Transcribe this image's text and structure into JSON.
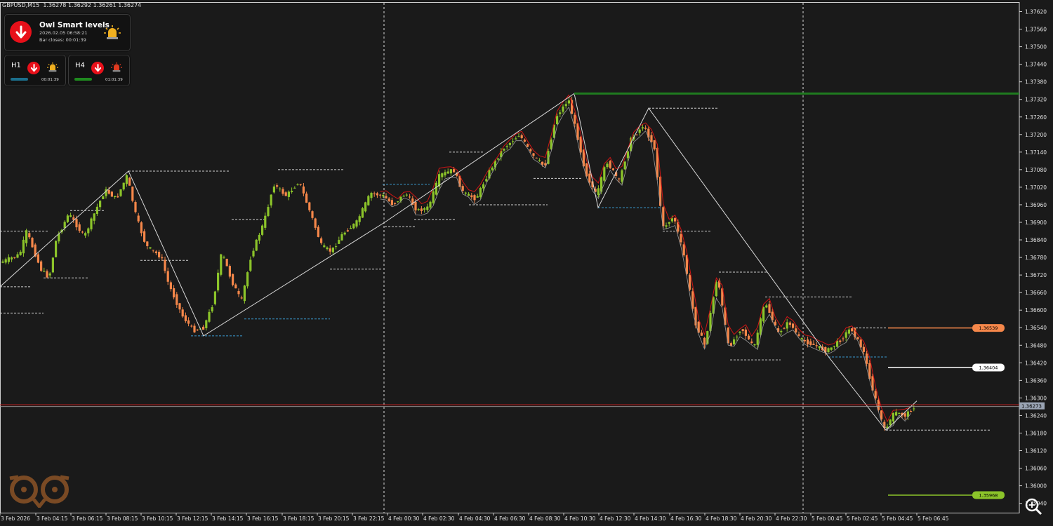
{
  "symbol_info": "GBPUSD,M15  1.36278 1.36292 1.36261 1.36274",
  "panel": {
    "title": "Owl Smart levels",
    "datetime": "2026.02.05 06:58:21",
    "bar_closes": "Bar closes: 00:01:39",
    "tf1": {
      "label": "H1",
      "time": "00:01:39",
      "bar_color": "#1b6f8c"
    },
    "tf2": {
      "label": "H4",
      "time": "01:01:39",
      "bar_color": "#1f8a1f"
    }
  },
  "colors": {
    "background": "#1a1a1a",
    "bull": "#8cc42a",
    "bear": "#f5874a",
    "zigzag": "#d8d8d8",
    "envelope": "#d01515",
    "level_top": "#1f7a1f",
    "level_orange": "#f5874a",
    "level_white": "#ffffff",
    "level_green": "#8cc42a",
    "price_line": "#d02020"
  },
  "chart_data": {
    "type": "candlestick",
    "symbol": "GBPUSD",
    "timeframe": "M15",
    "ylim": [
      1.35908,
      1.3765
    ],
    "y_ticks": [
      "1.37620",
      "1.37560",
      "1.37500",
      "1.37440",
      "1.37380",
      "1.37320",
      "1.37260",
      "1.37200",
      "1.37140",
      "1.37080",
      "1.37020",
      "1.36960",
      "1.36900",
      "1.36840",
      "1.36780",
      "1.36720",
      "1.36660",
      "1.36600",
      "1.36540",
      "1.36480",
      "1.36420",
      "1.36360",
      "1.36300",
      "1.36240",
      "1.36180",
      "1.36120",
      "1.36060",
      "1.36000",
      "1.35940"
    ],
    "x_labels": [
      "3 Feb 2026",
      "3 Feb 04:15",
      "3 Feb 06:15",
      "3 Feb 08:15",
      "3 Feb 10:15",
      "3 Feb 12:15",
      "3 Feb 14:15",
      "3 Feb 16:15",
      "3 Feb 18:15",
      "3 Feb 20:15",
      "3 Feb 22:15",
      "4 Feb 00:30",
      "4 Feb 02:30",
      "4 Feb 04:30",
      "4 Feb 06:30",
      "4 Feb 08:30",
      "4 Feb 10:30",
      "4 Feb 12:30",
      "4 Feb 14:30",
      "4 Feb 16:30",
      "4 Feb 18:30",
      "4 Feb 20:30",
      "4 Feb 22:30",
      "5 Feb 00:45",
      "5 Feb 02:45",
      "5 Feb 04:45",
      "5 Feb 06:45"
    ],
    "day_separators": [
      "4 Feb 00:00",
      "5 Feb 00:00"
    ],
    "current_price": {
      "value": 1.36273,
      "label": "1.36273"
    },
    "levels": [
      {
        "name": "resistance-top",
        "value": 1.3734,
        "label": "",
        "color": "#1f7a1f"
      },
      {
        "name": "level-orange",
        "value": 1.36539,
        "label": "1.36539",
        "color": "#f5874a"
      },
      {
        "name": "level-white",
        "value": 1.36404,
        "label": "1.36404",
        "color": "#ffffff"
      },
      {
        "name": "level-green",
        "value": 1.35968,
        "label": "1.35968",
        "color": "#8cc42a"
      }
    ],
    "price_path": [
      [
        0,
        1.3676
      ],
      [
        30,
        1.3679
      ],
      [
        40,
        1.3687
      ],
      [
        60,
        1.3674
      ],
      [
        72,
        1.3671
      ],
      [
        82,
        1.3684
      ],
      [
        100,
        1.3693
      ],
      [
        122,
        1.3685
      ],
      [
        140,
        1.3695
      ],
      [
        152,
        1.3701
      ],
      [
        168,
        1.3698
      ],
      [
        183,
        1.3706
      ],
      [
        196,
        1.3692
      ],
      [
        210,
        1.3682
      ],
      [
        232,
        1.3678
      ],
      [
        242,
        1.3669
      ],
      [
        262,
        1.3658
      ],
      [
        278,
        1.3653
      ],
      [
        292,
        1.3654
      ],
      [
        305,
        1.3662
      ],
      [
        318,
        1.368
      ],
      [
        332,
        1.367
      ],
      [
        346,
        1.3663
      ],
      [
        360,
        1.3679
      ],
      [
        378,
        1.369
      ],
      [
        392,
        1.3703
      ],
      [
        410,
        1.3699
      ],
      [
        428,
        1.3704
      ],
      [
        446,
        1.3692
      ],
      [
        460,
        1.3682
      ],
      [
        474,
        1.368
      ],
      [
        490,
        1.3686
      ],
      [
        510,
        1.369
      ],
      [
        530,
        1.37
      ],
      [
        548,
        1.3699
      ],
      [
        562,
        1.3696
      ],
      [
        580,
        1.37
      ],
      [
        596,
        1.3694
      ],
      [
        612,
        1.3695
      ],
      [
        628,
        1.3706
      ],
      [
        648,
        1.3708
      ],
      [
        662,
        1.37
      ],
      [
        680,
        1.3698
      ],
      [
        698,
        1.3707
      ],
      [
        718,
        1.3715
      ],
      [
        742,
        1.372
      ],
      [
        760,
        1.3713
      ],
      [
        778,
        1.3709
      ],
      [
        794,
        1.3726
      ],
      [
        812,
        1.3732
      ],
      [
        824,
        1.372
      ],
      [
        836,
        1.3707
      ],
      [
        852,
        1.3699
      ],
      [
        866,
        1.3711
      ],
      [
        884,
        1.3704
      ],
      [
        900,
        1.3718
      ],
      [
        918,
        1.3723
      ],
      [
        934,
        1.3716
      ],
      [
        946,
        1.3688
      ],
      [
        962,
        1.3692
      ],
      [
        976,
        1.3679
      ],
      [
        992,
        1.3656
      ],
      [
        1006,
        1.3648
      ],
      [
        1024,
        1.3672
      ],
      [
        1040,
        1.3647
      ],
      [
        1058,
        1.3654
      ],
      [
        1076,
        1.3647
      ],
      [
        1092,
        1.3663
      ],
      [
        1110,
        1.3652
      ],
      [
        1126,
        1.3656
      ],
      [
        1142,
        1.365
      ],
      [
        1162,
        1.3648
      ],
      [
        1180,
        1.3646
      ],
      [
        1200,
        1.365
      ],
      [
        1214,
        1.3654
      ],
      [
        1232,
        1.3646
      ],
      [
        1246,
        1.3632
      ],
      [
        1262,
        1.3619
      ],
      [
        1276,
        1.3625
      ],
      [
        1292,
        1.3624
      ],
      [
        1306,
        1.36274
      ]
    ],
    "zigzag": [
      [
        0,
        1.3668
      ],
      [
        183,
        1.37075
      ],
      [
        290,
        1.36512
      ],
      [
        548,
        1.369
      ],
      [
        818,
        1.3734
      ],
      [
        852,
        1.3695
      ],
      [
        924,
        1.3729
      ],
      [
        1182,
        1.36435
      ],
      [
        1262,
        1.3619
      ],
      [
        1306,
        1.3629
      ]
    ],
    "dashed_levels": [
      {
        "x1": 0,
        "x2": 45,
        "value": 1.3668,
        "color": "#cfcfcf"
      },
      {
        "x1": 0,
        "x2": 62,
        "value": 1.3659,
        "color": "#cfcfcf"
      },
      {
        "x1": 0,
        "x2": 70,
        "value": 1.3687,
        "color": "#cfcfcf"
      },
      {
        "x1": 62,
        "x2": 126,
        "value": 1.3671,
        "color": "#cfcfcf"
      },
      {
        "x1": 100,
        "x2": 150,
        "value": 1.3694,
        "color": "#cfcfcf"
      },
      {
        "x1": 183,
        "x2": 326,
        "value": 1.37075,
        "color": "#cfcfcf"
      },
      {
        "x1": 200,
        "x2": 268,
        "value": 1.3677,
        "color": "#cfcfcf"
      },
      {
        "x1": 272,
        "x2": 345,
        "value": 1.36512,
        "color": "#3a9ad0"
      },
      {
        "x1": 330,
        "x2": 378,
        "value": 1.3691,
        "color": "#cfcfcf"
      },
      {
        "x1": 348,
        "x2": 470,
        "value": 1.3657,
        "color": "#3a9ad0"
      },
      {
        "x1": 396,
        "x2": 490,
        "value": 1.3708,
        "color": "#cfcfcf"
      },
      {
        "x1": 470,
        "x2": 545,
        "value": 1.3674,
        "color": "#cfcfcf"
      },
      {
        "x1": 545,
        "x2": 612,
        "value": 1.3703,
        "color": "#3a9ad0"
      },
      {
        "x1": 548,
        "x2": 592,
        "value": 1.36885,
        "color": "#cfcfcf"
      },
      {
        "x1": 590,
        "x2": 648,
        "value": 1.3691,
        "color": "#cfcfcf"
      },
      {
        "x1": 640,
        "x2": 690,
        "value": 1.3714,
        "color": "#cfcfcf"
      },
      {
        "x1": 668,
        "x2": 780,
        "value": 1.3696,
        "color": "#cfcfcf"
      },
      {
        "x1": 760,
        "x2": 830,
        "value": 1.3705,
        "color": "#cfcfcf"
      },
      {
        "x1": 852,
        "x2": 940,
        "value": 1.3695,
        "color": "#3a9ad0"
      },
      {
        "x1": 924,
        "x2": 1024,
        "value": 1.3729,
        "color": "#cfcfcf"
      },
      {
        "x1": 944,
        "x2": 1012,
        "value": 1.3687,
        "color": "#cfcfcf"
      },
      {
        "x1": 1024,
        "x2": 1094,
        "value": 1.3673,
        "color": "#cfcfcf"
      },
      {
        "x1": 1040,
        "x2": 1112,
        "value": 1.3643,
        "color": "#cfcfcf"
      },
      {
        "x1": 1090,
        "x2": 1214,
        "value": 1.36645,
        "color": "#cfcfcf"
      },
      {
        "x1": 1180,
        "x2": 1264,
        "value": 1.3644,
        "color": "#3a9ad0"
      },
      {
        "x1": 1214,
        "x2": 1264,
        "value": 1.36539,
        "color": "#cfcfcf"
      },
      {
        "x1": 1262,
        "x2": 1412,
        "value": 1.3619,
        "color": "#cfcfcf"
      }
    ]
  }
}
